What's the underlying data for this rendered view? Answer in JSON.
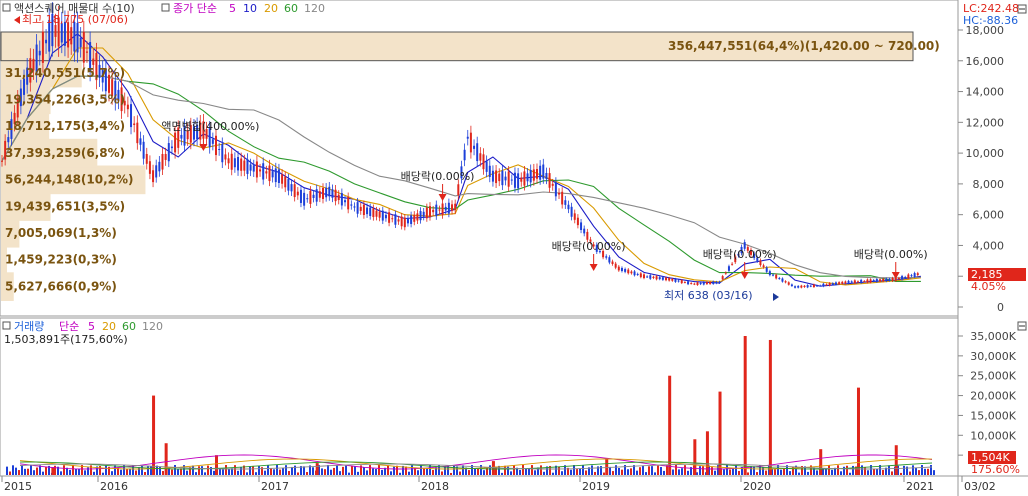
{
  "price_panel": {
    "legend_title": "액션스퀘어 매물대 수(10)",
    "legend_ma_label": "종가 단순",
    "ma_periods": [
      "5",
      "10",
      "20",
      "60",
      "120"
    ],
    "ma_colors": [
      "#7b2fbf",
      "#1c1cc7",
      "#d99a00",
      "#2e9a2e",
      "#888888"
    ],
    "lc_label": "LC:242.48",
    "hc_label": "HC:-88.36",
    "high_marker": "최고 18,775 (07/06)",
    "low_marker": "최저 638 (03/16)",
    "current_price": "2,185",
    "current_pct": "4.05%",
    "events": [
      {
        "text": "액면병합(400.00%)",
        "x": "2016-05"
      },
      {
        "text": "배당락(0.00%)",
        "x": "2017-12"
      },
      {
        "text": "배당락(0.00%)",
        "x": "2018-12"
      },
      {
        "text": "배당락(0.00%)",
        "x": "2019-12"
      },
      {
        "text": "배당락(0.00%)",
        "x": "2020-12"
      }
    ]
  },
  "volume_panel": {
    "legend_title": "거래량",
    "legend_ma_label": "단순",
    "ma_periods": [
      "5",
      "20",
      "60",
      "120"
    ],
    "ma_colors": [
      "#c000c0",
      "#d99a00",
      "#2e9a2e",
      "#888888"
    ],
    "top_readout": "1,503,891주(175,60%)",
    "current_volume": "1,504K",
    "current_pct": "175.60%"
  },
  "x_axis_labels": [
    "2015",
    "2016",
    "2017",
    "2018",
    "2019",
    "2020",
    "2021",
    "03/02"
  ],
  "chart_data": {
    "type": "bar",
    "title": "액션스퀘어 매물대 수(10)",
    "price_axis": {
      "ticks": [
        0,
        2000,
        4000,
        6000,
        8000,
        10000,
        12000,
        14000,
        16000,
        18000
      ],
      "ylim": [
        -800,
        19200
      ]
    },
    "volume_axis": {
      "ticks": [
        "5,000K",
        "10,000K",
        "15,000K",
        "20,000K",
        "25,000K",
        "30,000K",
        "35,000K"
      ],
      "ylim": [
        0,
        37000
      ]
    },
    "volume_profile": [
      {
        "label": "5,627,666(0,9%)",
        "value": 5627666,
        "pct": 0.9
      },
      {
        "label": "1,459,223(0,3%)",
        "value": 1459223,
        "pct": 0.3
      },
      {
        "label": "7,005,069(1,3%)",
        "value": 7005069,
        "pct": 1.3
      },
      {
        "label": "19,439,651(3,5%)",
        "value": 19439651,
        "pct": 3.5
      },
      {
        "label": "56,244,148(10,2%)",
        "value": 56244148,
        "pct": 10.2
      },
      {
        "label": "37,393,259(6,8%)",
        "value": 37393259,
        "pct": 6.8
      },
      {
        "label": "18,712,175(3,4%)",
        "value": 18712175,
        "pct": 3.4
      },
      {
        "label": "19,354,226(3,5%)",
        "value": 19354226,
        "pct": 3.5
      },
      {
        "label": "31,240,551(5,7%)",
        "value": 31240551,
        "pct": 5.7
      },
      {
        "label": "356,447,551(64,4%)(1,420.00 ~ 720.00)",
        "value": 356447551,
        "pct": 64.4
      }
    ],
    "price_series": {
      "name": "종가",
      "x": [
        "2015-01",
        "2015-03",
        "2015-05",
        "2015-07",
        "2015-09",
        "2015-11",
        "2016-01",
        "2016-03",
        "2016-05",
        "2016-07",
        "2016-09",
        "2016-11",
        "2017-01",
        "2017-03",
        "2017-05",
        "2017-07",
        "2017-09",
        "2017-11",
        "2018-01",
        "2018-02",
        "2018-04",
        "2018-06",
        "2018-08",
        "2018-10",
        "2018-12",
        "2019-02",
        "2019-04",
        "2019-06",
        "2019-08",
        "2019-10",
        "2019-12",
        "2020-02",
        "2020-04",
        "2020-06",
        "2020-08",
        "2020-10",
        "2020-12",
        "2021-02"
      ],
      "y": [
        9500,
        15000,
        18000,
        17500,
        15000,
        13000,
        8500,
        11000,
        11500,
        9500,
        9000,
        8500,
        7000,
        7500,
        6500,
        6000,
        5500,
        6200,
        6500,
        11000,
        8500,
        8200,
        8800,
        6500,
        4000,
        2500,
        2000,
        1800,
        1500,
        1600,
        4000,
        2200,
        1300,
        1400,
        1600,
        1700,
        1800,
        2185
      ]
    },
    "volume_series": {
      "name": "거래량",
      "x": [
        "2015-05",
        "2016-01",
        "2016-02",
        "2016-06",
        "2017-02",
        "2018-04",
        "2019-01",
        "2019-06",
        "2019-08",
        "2019-09",
        "2019-10",
        "2019-12",
        "2020-02",
        "2020-06",
        "2020-09",
        "2020-12"
      ],
      "y": [
        2000,
        20000,
        8000,
        5000,
        3000,
        3500,
        4000,
        25000,
        9000,
        11000,
        21000,
        35000,
        34000,
        6500,
        22000,
        7500
      ]
    }
  }
}
